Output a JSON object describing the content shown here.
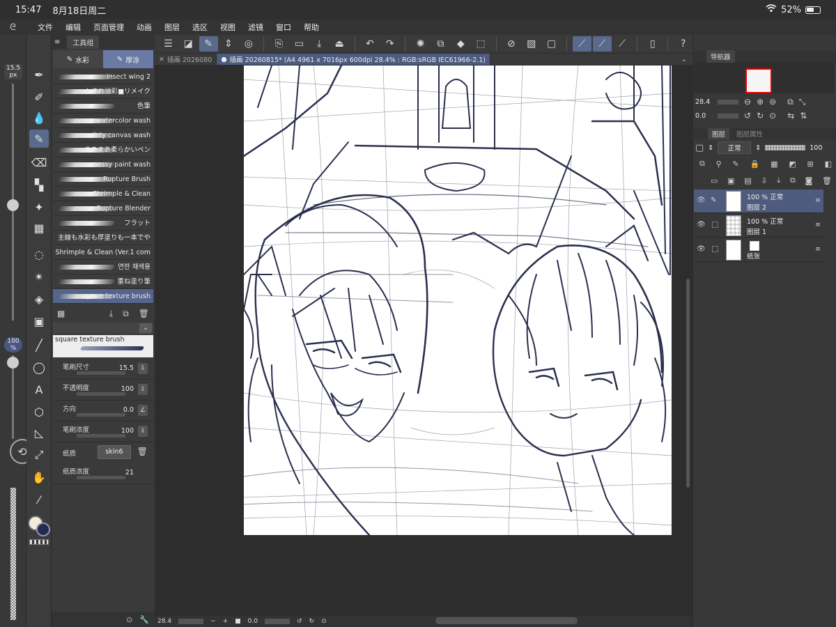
{
  "status": {
    "time": "15:47",
    "date": "8月18日周二",
    "battery": "52%"
  },
  "menu": [
    "文件",
    "编辑",
    "页面管理",
    "动画",
    "图层",
    "选区",
    "视图",
    "滤镜",
    "窗口",
    "帮助"
  ],
  "left": {
    "brush_size": "15.5",
    "brush_unit": "px",
    "opacity": "100",
    "opacity_unit": "%"
  },
  "brush_panel": {
    "title": "工具组",
    "subtabs": [
      "水彩",
      "厚涂"
    ],
    "brushes": [
      "insect wing 2",
      "かすれ油彩■リメイク",
      "色筆",
      "watercolor wash",
      "dirty canvas wash",
      "まあまあ柔らかいペン",
      "messy paint wash",
      "Rupture Brush",
      "Shrimple & Clean",
      "Rupture Blender",
      "フラット",
      "主線も水彩も厚塗りも一本でや",
      "Shrimple & Clean (Ver.1 com",
      "연한 채색용",
      "重ね塗り筆",
      "square texture brush"
    ],
    "preview_name": "square texture brush",
    "props": [
      {
        "label": "笔刷尺寸",
        "value": "15.5"
      },
      {
        "label": "不透明度",
        "value": "100"
      },
      {
        "label": "方向",
        "value": "0.0"
      },
      {
        "label": "笔刷浓度",
        "value": "100"
      }
    ],
    "texture_label": "纸质",
    "texture_value": "skin6",
    "texture_density_label": "纸质浓度",
    "texture_density_value": "21"
  },
  "tabs": [
    {
      "label": "插画 2026080"
    },
    {
      "label": "插画 20260815* (A4 4961 x 7016px 600dpi 28.4% : RGB:sRGB IEC61966-2.1)"
    }
  ],
  "bottom": {
    "zoom": "28.4",
    "angle": "0.0"
  },
  "navigator": {
    "title": "导航器",
    "zoom": "28.4",
    "angle": "0.0"
  },
  "layers_panel": {
    "tab1": "图层",
    "tab2": "图层属性",
    "blend": "正常",
    "opacity": "100",
    "layers": [
      {
        "line1": "100 % 正常",
        "line2": "图层 2"
      },
      {
        "line1": "100 % 正常",
        "line2": "图层 1"
      },
      {
        "line1": "",
        "line2": "纸张"
      }
    ]
  },
  "colors": {
    "accent": "#5a6a8c",
    "main_color": "#f3ebdc",
    "sub_color": "#252b4a"
  }
}
